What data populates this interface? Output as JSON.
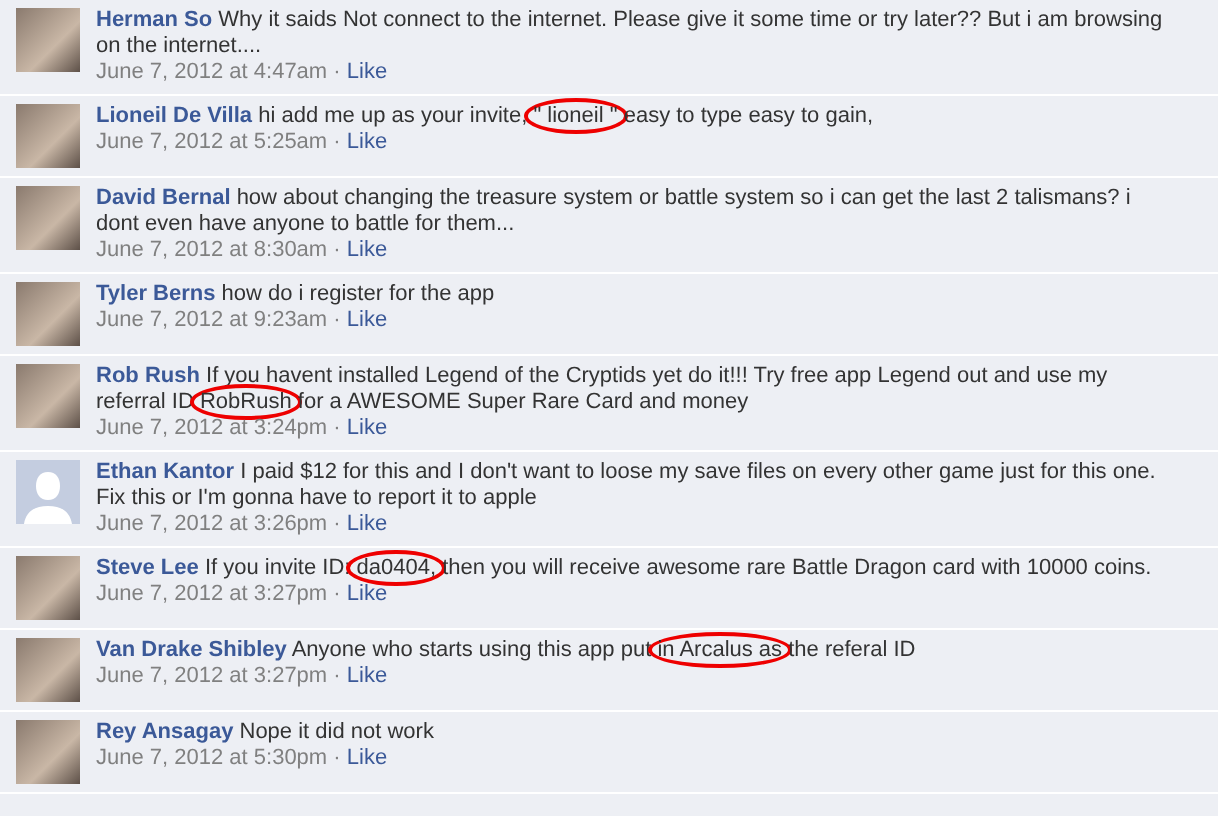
{
  "comments": [
    {
      "author": "Herman So",
      "segments": [
        {
          "text": "Why it saids Not connect to the internet. Please give it some time or try later?? But i am browsing on the internet....",
          "circled": false
        }
      ],
      "time": "June 7, 2012 at 4:47am",
      "separator": "·",
      "like": "Like",
      "kind": "photo"
    },
    {
      "author": "Lioneil De Villa",
      "segments": [
        {
          "text": "hi add me up as your invite,",
          "circled": false
        },
        {
          "text": "\" lioneil \"",
          "circled": true
        },
        {
          "text": "easy to type easy to gain,",
          "circled": false
        }
      ],
      "time": "June 7, 2012 at 5:25am",
      "separator": "·",
      "like": "Like",
      "kind": "photo"
    },
    {
      "author": "David Bernal",
      "segments": [
        {
          "text": "how about changing the treasure system or battle system so i can get the last 2 talismans? i dont even have anyone to battle for them...",
          "circled": false
        }
      ],
      "time": "June 7, 2012 at 8:30am",
      "separator": "·",
      "like": "Like",
      "kind": "photo"
    },
    {
      "author": "Tyler Berns",
      "segments": [
        {
          "text": "how do i register for the app",
          "circled": false
        }
      ],
      "time": "June 7, 2012 at 9:23am",
      "separator": "·",
      "like": "Like",
      "kind": "photo"
    },
    {
      "author": "Rob Rush",
      "segments": [
        {
          "text": "If you havent installed Legend of the Cryptids yet do it!!! Try free app Legend out and use my referral ID",
          "circled": false
        },
        {
          "text": "RobRush",
          "circled": true
        },
        {
          "text": "for a AWESOME Super Rare Card and money",
          "circled": false
        }
      ],
      "time": "June 7, 2012 at 3:24pm",
      "separator": "·",
      "like": "Like",
      "kind": "photo"
    },
    {
      "author": "Ethan Kantor",
      "segments": [
        {
          "text": "I paid $12 for this and I don't want to loose my save files on every other game just for this one. Fix this or I'm gonna have to report it to apple",
          "circled": false
        }
      ],
      "time": "June 7, 2012 at 3:26pm",
      "separator": "·",
      "like": "Like",
      "kind": "silhouette"
    },
    {
      "author": "Steve Lee",
      "segments": [
        {
          "text": "If you invite ID:",
          "circled": false
        },
        {
          "text": "da0404,",
          "circled": true
        },
        {
          "text": "then you will receive awesome rare Battle Dragon card with 10000 coins.",
          "circled": false
        }
      ],
      "time": "June 7, 2012 at 3:27pm",
      "separator": "·",
      "like": "Like",
      "kind": "photo"
    },
    {
      "author": "Van Drake Shibley",
      "segments": [
        {
          "text": "Anyone who starts using this app put",
          "circled": false
        },
        {
          "text": "in Arcalus as",
          "circled": true
        },
        {
          "text": "the referal ID",
          "circled": false
        }
      ],
      "time": "June 7, 2012 at 3:27pm",
      "separator": "·",
      "like": "Like",
      "kind": "photo"
    },
    {
      "author": "Rey Ansagay",
      "segments": [
        {
          "text": "Nope it did not work",
          "circled": false
        }
      ],
      "time": "June 7, 2012 at 5:30pm",
      "separator": "·",
      "like": "Like",
      "kind": "photo"
    }
  ]
}
